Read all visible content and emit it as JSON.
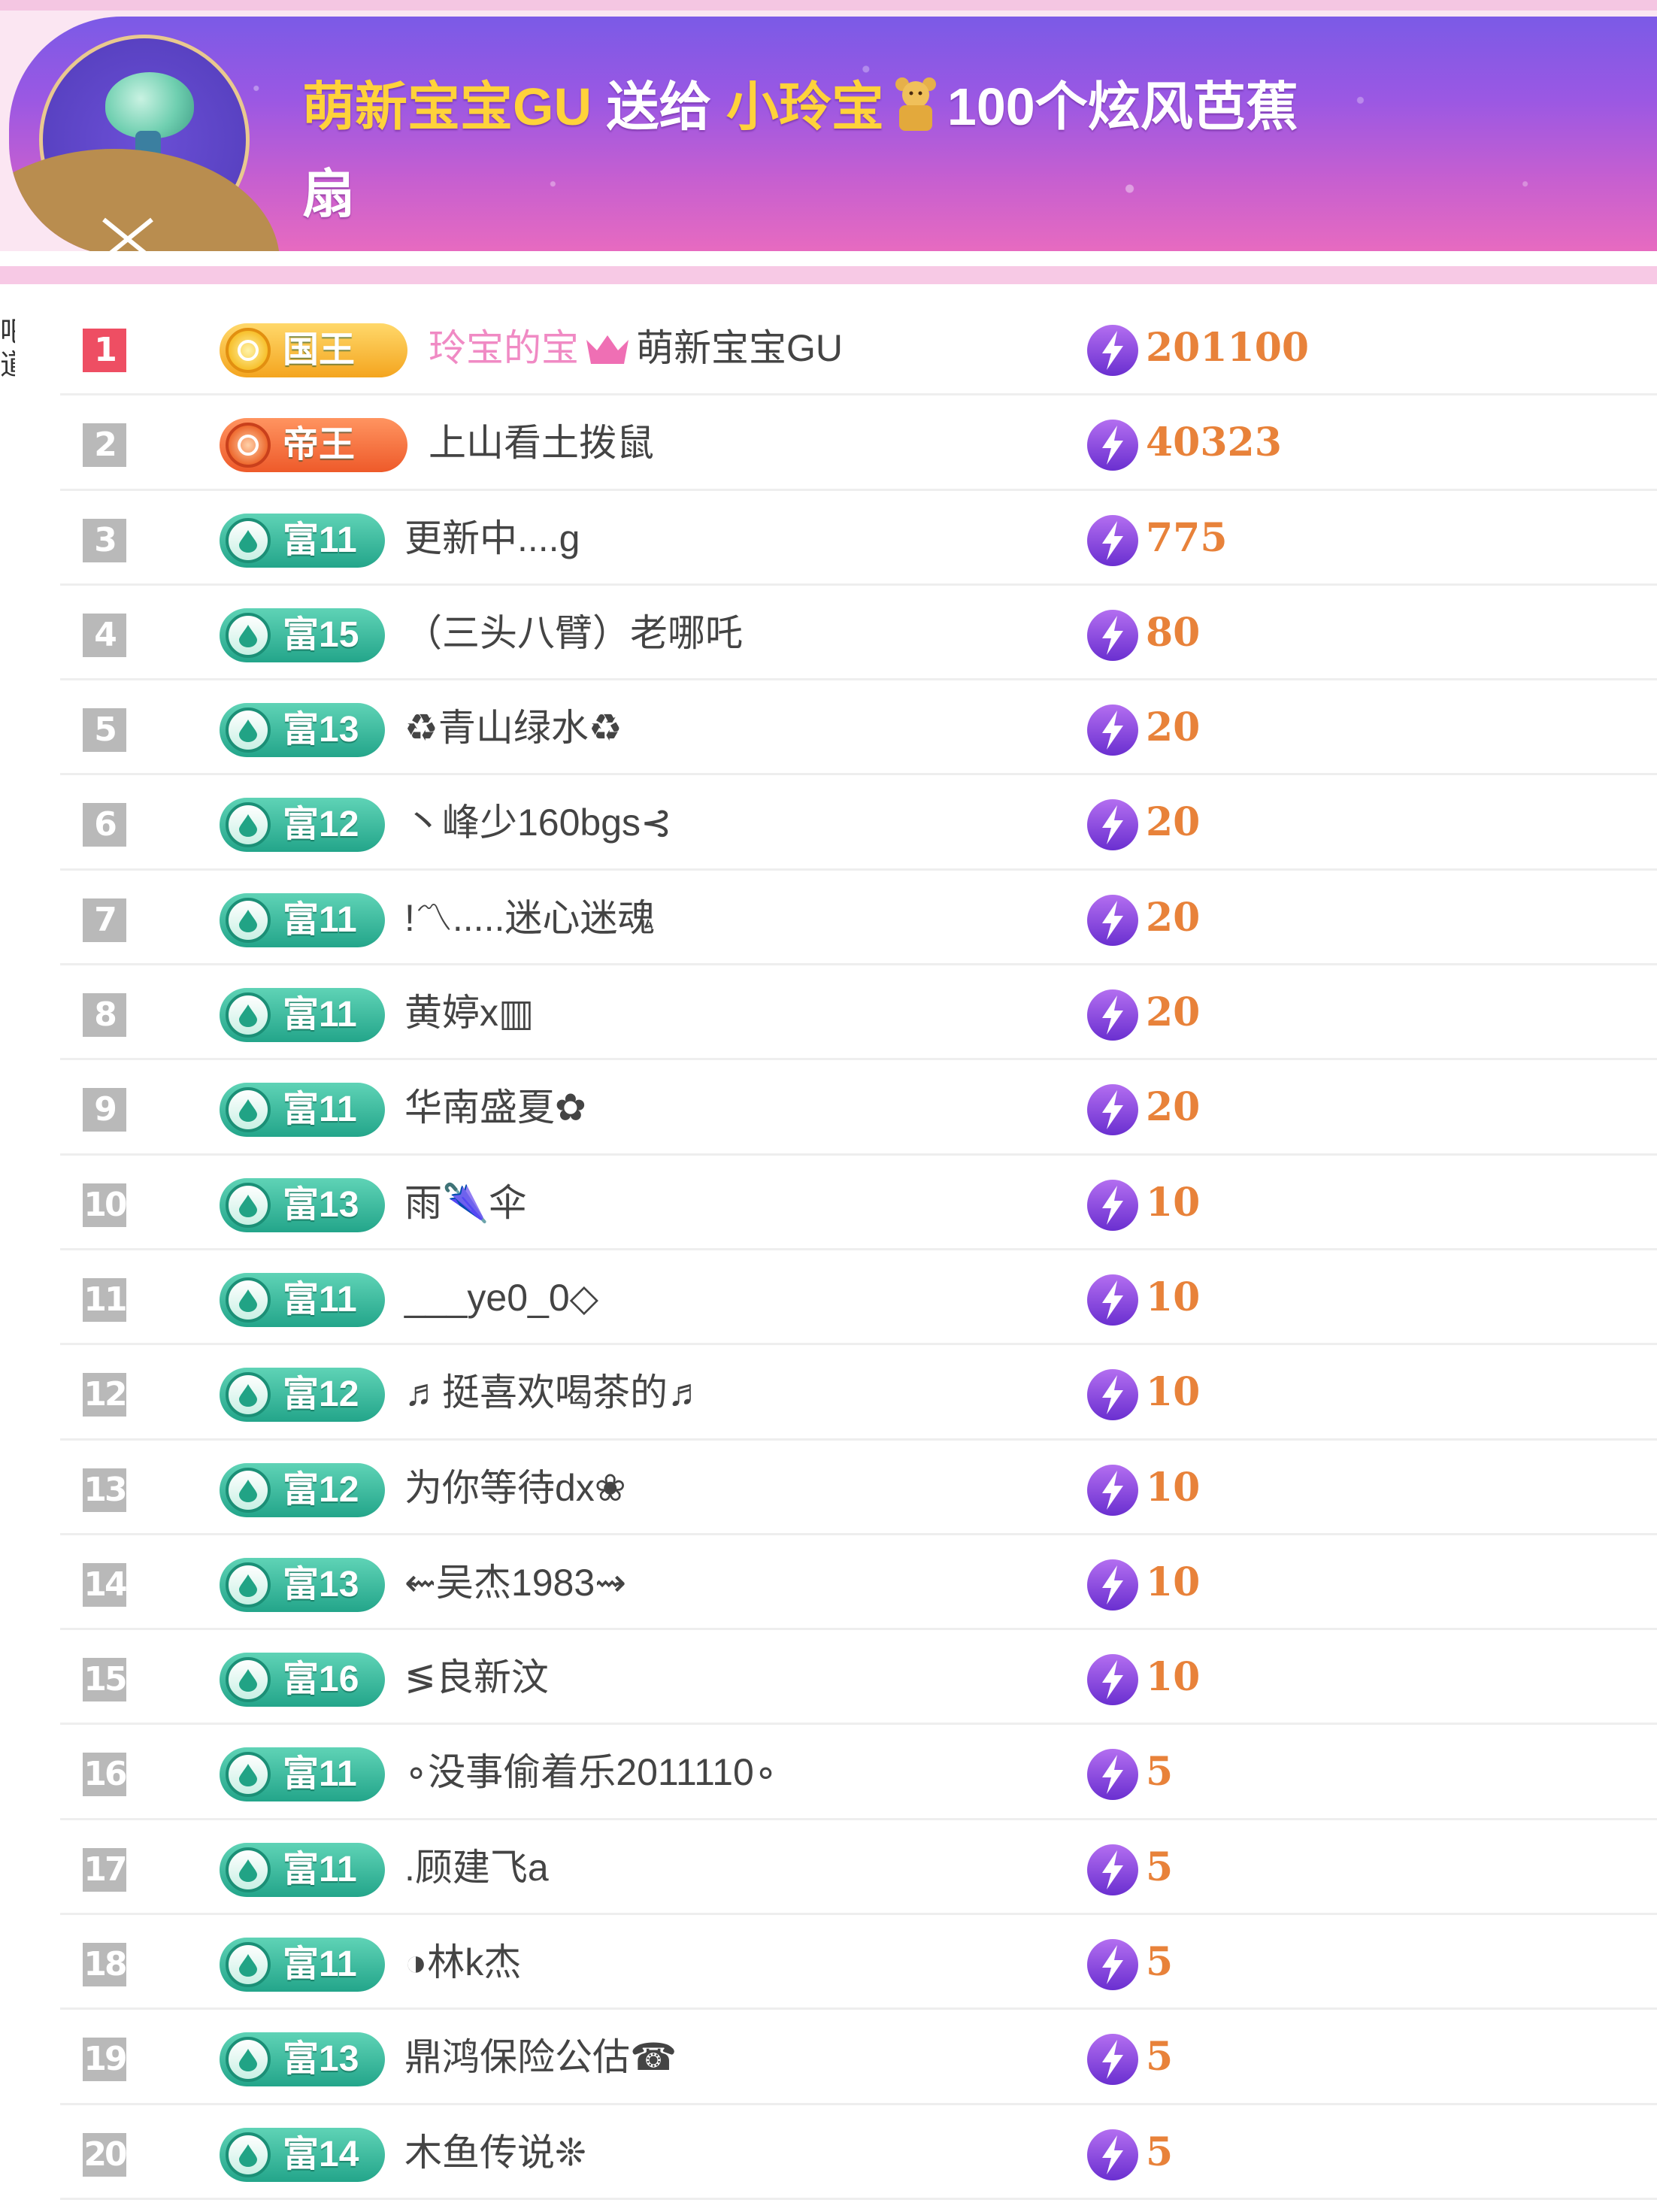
{
  "banner": {
    "sender": "萌新宝宝GU",
    "send_word": "送给",
    "receiver": "小玲宝",
    "gift_text_line1": "100个炫风芭蕉",
    "gift_text_line2": "扇"
  },
  "left_edge_text": "吧道",
  "rows": [
    {
      "rank": "1",
      "badge": "国王",
      "badge_type": "king",
      "name_prefix": "玲宝的宝",
      "name": "萌新宝宝GU",
      "score": "201100"
    },
    {
      "rank": "2",
      "badge": "帝王",
      "badge_type": "emperor",
      "name": "上山看土拨鼠",
      "score": "40323"
    },
    {
      "rank": "3",
      "badge": "富11",
      "name": "更新中....g",
      "score": "775"
    },
    {
      "rank": "4",
      "badge": "富15",
      "name": "（三头八臂）老哪吒",
      "score": "80"
    },
    {
      "rank": "5",
      "badge": "富13",
      "name": "♻青山绿水♻",
      "score": "20"
    },
    {
      "rank": "6",
      "badge": "富12",
      "name": "丶峰少160bgs⊰",
      "score": "20"
    },
    {
      "rank": "7",
      "badge": "富11",
      "name": "!〽.....迷心迷魂",
      "score": "20"
    },
    {
      "rank": "8",
      "badge": "富11",
      "name": "黄婷x▥",
      "score": "20"
    },
    {
      "rank": "9",
      "badge": "富11",
      "name": "华南盛夏✿",
      "score": "20"
    },
    {
      "rank": "10",
      "badge": "富13",
      "name": "雨🌂伞",
      "score": "10"
    },
    {
      "rank": "11",
      "badge": "富11",
      "name": "___ye0_0◇",
      "score": "10"
    },
    {
      "rank": "12",
      "badge": "富12",
      "name": "♬挺喜欢喝茶的♬",
      "score": "10"
    },
    {
      "rank": "13",
      "badge": "富12",
      "name": "为你等待dx❀",
      "score": "10"
    },
    {
      "rank": "14",
      "badge": "富13",
      "name": "⇜吴杰1983⇝",
      "score": "10"
    },
    {
      "rank": "15",
      "badge": "富16",
      "name": "≶良新汶",
      "score": "10"
    },
    {
      "rank": "16",
      "badge": "富11",
      "name": "∘没事偷着乐2011110∘",
      "score": "5"
    },
    {
      "rank": "17",
      "badge": "富11",
      "name": ".顾建飞a",
      "score": "5"
    },
    {
      "rank": "18",
      "badge": "富11",
      "name": "◑林k杰",
      "score": "5"
    },
    {
      "rank": "19",
      "badge": "富13",
      "name": "鼎鸿保险公估☎",
      "score": "5"
    },
    {
      "rank": "20",
      "badge": "富14",
      "name": "木鱼传说❊",
      "score": "5"
    }
  ]
}
